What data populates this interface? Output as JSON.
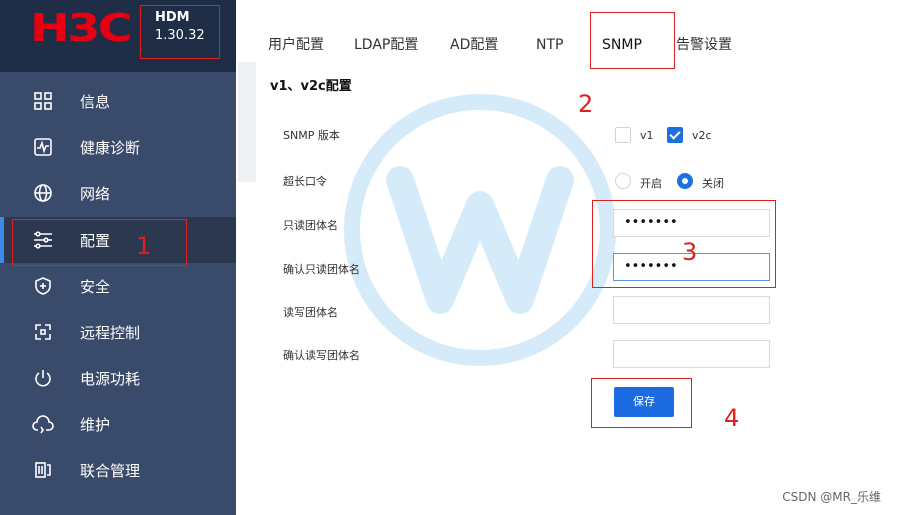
{
  "brand": {
    "logo_text": "H3C",
    "product": "HDM",
    "version": "1.30.32"
  },
  "sidebar": {
    "items": [
      {
        "label": "信息",
        "icon": "grid-icon"
      },
      {
        "label": "健康诊断",
        "icon": "health-monitor-icon"
      },
      {
        "label": "网络",
        "icon": "globe-icon"
      },
      {
        "label": "配置",
        "icon": "sliders-icon",
        "active": true
      },
      {
        "label": "安全",
        "icon": "shield-plus-icon"
      },
      {
        "label": "远程控制",
        "icon": "remote-icon"
      },
      {
        "label": "电源功耗",
        "icon": "power-icon"
      },
      {
        "label": "维护",
        "icon": "cloud-refresh-icon"
      },
      {
        "label": "联合管理",
        "icon": "federation-icon"
      }
    ]
  },
  "tabs": [
    {
      "label": "用户配置"
    },
    {
      "label": "LDAP配置"
    },
    {
      "label": "AD配置"
    },
    {
      "label": "NTP"
    },
    {
      "label": "SNMP",
      "active": true
    },
    {
      "label": "告警设置"
    }
  ],
  "form": {
    "section_title": "v1、v2c配置",
    "snmp_version_label": "SNMP 版本",
    "snmp_version_options": [
      {
        "label": "v1",
        "checked": false
      },
      {
        "label": "v2c",
        "checked": true
      }
    ],
    "long_password_label": "超长口令",
    "long_password_options": [
      {
        "label": "开启",
        "selected": false
      },
      {
        "label": "关闭",
        "selected": true
      }
    ],
    "ro_community_label": "只读团体名",
    "ro_community_value": "•••••••",
    "ro_community_confirm_label": "确认只读团体名",
    "ro_community_confirm_value": "•••••••",
    "rw_community_label": "读写团体名",
    "rw_community_value": "",
    "rw_community_confirm_label": "确认读写团体名",
    "rw_community_confirm_value": "",
    "save_label": "保存"
  },
  "annotations": [
    "1",
    "2",
    "3",
    "4"
  ],
  "footer": {
    "credit": "CSDN @MR_乐维"
  },
  "colors": {
    "sidebar_bg": "#3a4a6a",
    "accent": "#1c6be0",
    "annotation": "#e0201c",
    "logo": "#e60012"
  }
}
